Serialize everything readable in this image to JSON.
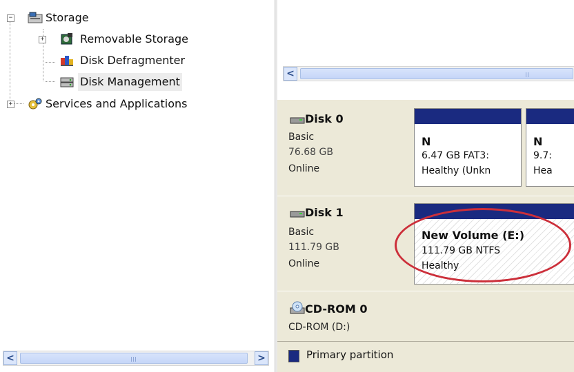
{
  "tree": {
    "items": [
      {
        "label": "Storage",
        "icon": "storage-icon",
        "expander": "−"
      },
      {
        "label": "Removable Storage",
        "icon": "removable-storage-icon",
        "expander": "+"
      },
      {
        "label": "Disk Defragmenter",
        "icon": "disk-defragmenter-icon"
      },
      {
        "label": "Disk Management",
        "icon": "disk-management-icon",
        "selected": true
      },
      {
        "label": "Services and Applications",
        "icon": "services-applications-icon",
        "expander": "+"
      }
    ]
  },
  "scrollbar": {
    "left_arrow": "<",
    "right_arrow": ">"
  },
  "disks": [
    {
      "name": "Disk 0",
      "type": "Basic",
      "size": "76.68 GB",
      "status": "Online",
      "partitions": [
        {
          "name": "N",
          "size_fs": "6.47 GB FAT3:",
          "status": "Healthy (Unkn"
        },
        {
          "name": "N",
          "size_fs": "9.7:",
          "status": "Hea"
        }
      ]
    },
    {
      "name": "Disk 1",
      "type": "Basic",
      "size": "111.79 GB",
      "status": "Online",
      "partitions": [
        {
          "name": "New Volume  (E:)",
          "size_fs": "111.79 GB NTFS",
          "status": "Healthy"
        }
      ]
    },
    {
      "name": "CD-ROM 0",
      "type": "CD-ROM (D:)"
    }
  ],
  "legend": {
    "label": "Primary partition",
    "color": "#1a2a80"
  },
  "colors": {
    "highlight": "#cc2f3a",
    "partition_bar": "#1a2a80",
    "panel_bg": "#ece9d8"
  }
}
